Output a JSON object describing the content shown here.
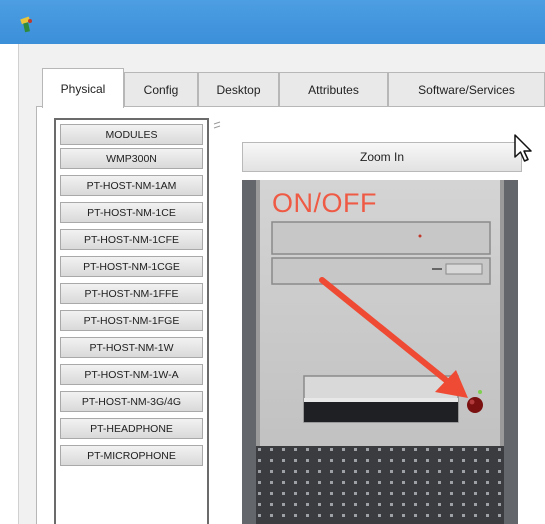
{
  "window": {
    "app_icon": "packet-tracer-icon",
    "accent_color": "#3b8fd9"
  },
  "tabs": [
    {
      "label": "Physical",
      "active": true
    },
    {
      "label": "Config",
      "active": false
    },
    {
      "label": "Desktop",
      "active": false
    },
    {
      "label": "Attributes",
      "active": false
    },
    {
      "label": "Software/Services",
      "active": false
    }
  ],
  "modules": {
    "items": [
      "MODULES",
      "WMP300N",
      "PT-HOST-NM-1AM",
      "PT-HOST-NM-1CE",
      "PT-HOST-NM-1CFE",
      "PT-HOST-NM-1CGE",
      "PT-HOST-NM-1FFE",
      "PT-HOST-NM-1FGE",
      "PT-HOST-NM-1W",
      "PT-HOST-NM-1W-A",
      "PT-HOST-NM-3G/4G",
      "PT-HEADPHONE",
      "PT-MICROPHONE"
    ]
  },
  "physical_view": {
    "zoom_button_label": "Zoom In",
    "device_annotation": "ON/OFF",
    "annotation_color": "#ef5a45",
    "power_button_color": "#7a1010"
  }
}
